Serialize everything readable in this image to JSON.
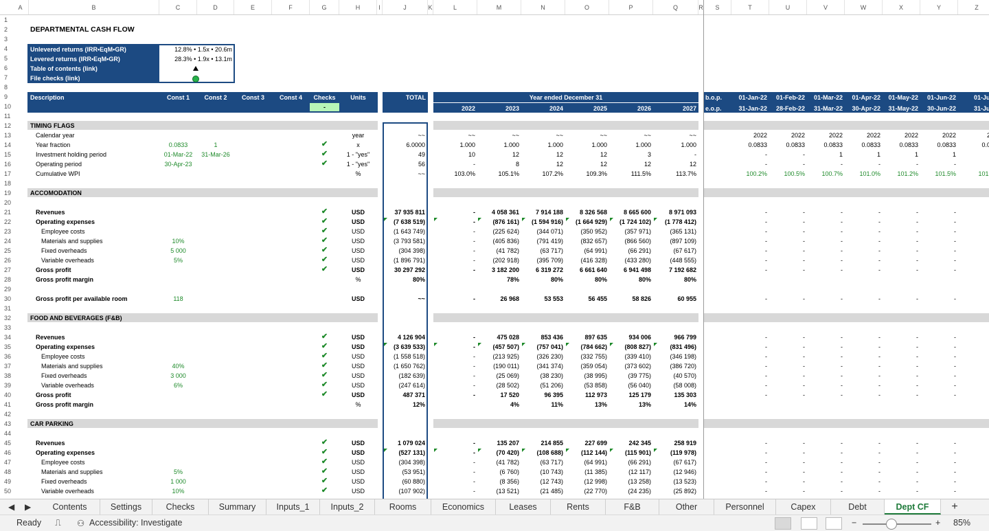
{
  "columns": [
    "A",
    "B",
    "C",
    "D",
    "E",
    "F",
    "G",
    "H",
    "I",
    "J",
    "K",
    "L",
    "M",
    "N",
    "O",
    "P",
    "Q",
    "R",
    "S",
    "T",
    "U",
    "V",
    "W",
    "X",
    "Y",
    "Z"
  ],
  "title": "DEPARTMENTAL CASH FLOW",
  "summary_box": {
    "rows": [
      {
        "label": "Unlevered returns (IRR•EqM•GR)",
        "value": "12.8% • 1.5x • 20.6m"
      },
      {
        "label": "Levered returns (IRR•EqM•GR)",
        "value": "28.3% • 1.9x • 13.1m"
      },
      {
        "label": "Table of contents (link)",
        "value": ""
      },
      {
        "label": "File checks (link)",
        "value": ""
      }
    ]
  },
  "header": {
    "description": "Description",
    "const": [
      "Const 1",
      "Const 2",
      "Const 3",
      "Const 4"
    ],
    "checks": "Checks",
    "checks_value": "-",
    "units": "Units",
    "total": "TOTAL",
    "year_ended": "Year ended December 31",
    "years": [
      "2022",
      "2023",
      "2024",
      "2025",
      "2026",
      "2027"
    ],
    "bop": "b.o.p.",
    "eop": "e.o.p.",
    "month_starts": [
      "01-Jan-22",
      "01-Feb-22",
      "01-Mar-22",
      "01-Apr-22",
      "01-May-22",
      "01-Jun-22",
      "01-Jul-"
    ],
    "month_ends": [
      "31-Jan-22",
      "28-Feb-22",
      "31-Mar-22",
      "30-Apr-22",
      "31-May-22",
      "30-Jun-22",
      "31-Jul-"
    ]
  },
  "rows": [
    {
      "r": 12,
      "type": "section",
      "label": "TIMING FLAGS"
    },
    {
      "r": 13,
      "label": "Calendar year",
      "units": "year",
      "total": "~~",
      "years": [
        "~~",
        "~~",
        "~~",
        "~~",
        "~~",
        "~~"
      ],
      "months": [
        "2022",
        "2022",
        "2022",
        "2022",
        "2022",
        "2022",
        "20"
      ]
    },
    {
      "r": 14,
      "label": "Year fraction",
      "c1": "0.0833",
      "c2": "1",
      "check": true,
      "units": "x",
      "total": "6.0000",
      "years": [
        "1.000",
        "1.000",
        "1.000",
        "1.000",
        "1.000",
        "1.000"
      ],
      "months": [
        "0.0833",
        "0.0833",
        "0.0833",
        "0.0833",
        "0.0833",
        "0.0833",
        "0.08"
      ]
    },
    {
      "r": 15,
      "label": "Investment holding period",
      "c1": "01-Mar-22",
      "c2": "31-Mar-26",
      "check": true,
      "units": "1 - \"yes\"",
      "total": "49",
      "years": [
        "10",
        "12",
        "12",
        "12",
        "3",
        "-"
      ],
      "months": [
        "-",
        "-",
        "1",
        "1",
        "1",
        "1",
        ""
      ]
    },
    {
      "r": 16,
      "label": "Operating period",
      "c1": "30-Apr-23",
      "check": true,
      "units": "1 - \"yes\"",
      "total": "56",
      "years": [
        "-",
        "8",
        "12",
        "12",
        "12",
        "12"
      ],
      "months": [
        "-",
        "-",
        "-",
        "-",
        "-",
        "-",
        ""
      ]
    },
    {
      "r": 17,
      "label": "Cumulative WPI",
      "units": "%",
      "total": "~~",
      "years": [
        "103.0%",
        "105.1%",
        "107.2%",
        "109.3%",
        "111.5%",
        "113.7%"
      ],
      "months": [
        "100.2%",
        "100.5%",
        "100.7%",
        "101.0%",
        "101.2%",
        "101.5%",
        "101.7"
      ],
      "mgreen": true
    },
    {
      "r": 19,
      "type": "section",
      "label": "ACCOMODATION"
    },
    {
      "r": 21,
      "label": "Revenues",
      "bold": true,
      "check": true,
      "units": "USD",
      "total": "37 935 811",
      "years": [
        "-",
        "4 058 361",
        "7 914 188",
        "8 326 568",
        "8 665 600",
        "8 971 093"
      ],
      "months": [
        "-",
        "-",
        "-",
        "-",
        "-",
        "-",
        ""
      ]
    },
    {
      "r": 22,
      "label": "Operating expenses",
      "bold": true,
      "check": true,
      "units": "USD",
      "total": "(7 638 519)",
      "years": [
        "-",
        "(876 161)",
        "(1 594 916)",
        "(1 664 929)",
        "(1 724 102)",
        "(1 778 412)"
      ],
      "months": [
        "-",
        "-",
        "-",
        "-",
        "-",
        "-",
        ""
      ],
      "tri": true
    },
    {
      "r": 23,
      "label": "Employee costs",
      "indent": true,
      "check": true,
      "units": "USD",
      "total": "(1 643 749)",
      "years": [
        "-",
        "(225 624)",
        "(344 071)",
        "(350 952)",
        "(357 971)",
        "(365 131)"
      ],
      "months": [
        "-",
        "-",
        "-",
        "-",
        "-",
        "-",
        ""
      ]
    },
    {
      "r": 24,
      "label": "Materials and supplies",
      "indent": true,
      "c1": "10%",
      "check": true,
      "units": "USD",
      "total": "(3 793 581)",
      "years": [
        "-",
        "(405 836)",
        "(791 419)",
        "(832 657)",
        "(866 560)",
        "(897 109)"
      ],
      "months": [
        "-",
        "-",
        "-",
        "-",
        "-",
        "-",
        ""
      ]
    },
    {
      "r": 25,
      "label": "Fixed overheads",
      "indent": true,
      "c1": "5 000",
      "check": true,
      "units": "USD",
      "total": "(304 398)",
      "years": [
        "-",
        "(41 782)",
        "(63 717)",
        "(64 991)",
        "(66 291)",
        "(67 617)"
      ],
      "months": [
        "-",
        "-",
        "-",
        "-",
        "-",
        "-",
        ""
      ]
    },
    {
      "r": 26,
      "label": "Variable overheads",
      "indent": true,
      "c1": "5%",
      "check": true,
      "units": "USD",
      "total": "(1 896 791)",
      "years": [
        "-",
        "(202 918)",
        "(395 709)",
        "(416 328)",
        "(433 280)",
        "(448 555)"
      ],
      "months": [
        "-",
        "-",
        "-",
        "-",
        "-",
        "-",
        ""
      ]
    },
    {
      "r": 27,
      "label": "Gross profit",
      "bold": true,
      "check": true,
      "units": "USD",
      "total": "30 297 292",
      "years": [
        "-",
        "3 182 200",
        "6 319 272",
        "6 661 640",
        "6 941 498",
        "7 192 682"
      ],
      "months": [
        "-",
        "-",
        "-",
        "-",
        "-",
        "-",
        ""
      ]
    },
    {
      "r": 28,
      "label": "Gross profit margin",
      "bold": true,
      "units": "%",
      "total": "80%",
      "years": [
        "",
        "78%",
        "80%",
        "80%",
        "80%",
        "80%"
      ],
      "months": [
        "",
        "",
        "",
        "",
        "",
        "",
        ""
      ]
    },
    {
      "r": 30,
      "label": "Gross profit per available room",
      "bold": true,
      "c1": "118",
      "units": "USD",
      "total": "~~",
      "years": [
        "-",
        "26 968",
        "53 553",
        "56 455",
        "58 826",
        "60 955"
      ],
      "months": [
        "-",
        "-",
        "-",
        "-",
        "-",
        "-",
        ""
      ]
    },
    {
      "r": 32,
      "type": "section",
      "label": "FOOD AND BEVERAGES (F&B)"
    },
    {
      "r": 34,
      "label": "Revenues",
      "bold": true,
      "check": true,
      "units": "USD",
      "total": "4 126 904",
      "years": [
        "-",
        "475 028",
        "853 436",
        "897 635",
        "934 006",
        "966 799"
      ],
      "months": [
        "-",
        "-",
        "-",
        "-",
        "-",
        "-",
        ""
      ]
    },
    {
      "r": 35,
      "label": "Operating expenses",
      "bold": true,
      "check": true,
      "units": "USD",
      "total": "(3 639 533)",
      "years": [
        "-",
        "(457 507)",
        "(757 041)",
        "(784 662)",
        "(808 827)",
        "(831 496)"
      ],
      "months": [
        "-",
        "-",
        "-",
        "-",
        "-",
        "-",
        ""
      ],
      "tri": true
    },
    {
      "r": 36,
      "label": "Employee costs",
      "indent": true,
      "check": true,
      "units": "USD",
      "total": "(1 558 518)",
      "years": [
        "-",
        "(213 925)",
        "(326 230)",
        "(332 755)",
        "(339 410)",
        "(346 198)"
      ],
      "months": [
        "-",
        "-",
        "-",
        "-",
        "-",
        "-",
        ""
      ]
    },
    {
      "r": 37,
      "label": "Materials and supplies",
      "indent": true,
      "c1": "40%",
      "check": true,
      "units": "USD",
      "total": "(1 650 762)",
      "years": [
        "-",
        "(190 011)",
        "(341 374)",
        "(359 054)",
        "(373 602)",
        "(386 720)"
      ],
      "months": [
        "-",
        "-",
        "-",
        "-",
        "-",
        "-",
        ""
      ]
    },
    {
      "r": 38,
      "label": "Fixed overheads",
      "indent": true,
      "c1": "3 000",
      "check": true,
      "units": "USD",
      "total": "(182 639)",
      "years": [
        "-",
        "(25 069)",
        "(38 230)",
        "(38 995)",
        "(39 775)",
        "(40 570)"
      ],
      "months": [
        "-",
        "-",
        "-",
        "-",
        "-",
        "-",
        ""
      ]
    },
    {
      "r": 39,
      "label": "Variable overheads",
      "indent": true,
      "c1": "6%",
      "check": true,
      "units": "USD",
      "total": "(247 614)",
      "years": [
        "-",
        "(28 502)",
        "(51 206)",
        "(53 858)",
        "(56 040)",
        "(58 008)"
      ],
      "months": [
        "-",
        "-",
        "-",
        "-",
        "-",
        "-",
        ""
      ]
    },
    {
      "r": 40,
      "label": "Gross profit",
      "bold": true,
      "check": true,
      "units": "USD",
      "total": "487 371",
      "years": [
        "-",
        "17 520",
        "96 395",
        "112 973",
        "125 179",
        "135 303"
      ],
      "months": [
        "-",
        "-",
        "-",
        "-",
        "-",
        "-",
        ""
      ]
    },
    {
      "r": 41,
      "label": "Gross profit margin",
      "bold": true,
      "units": "%",
      "total": "12%",
      "years": [
        "",
        "4%",
        "11%",
        "13%",
        "13%",
        "14%"
      ],
      "months": [
        "",
        "",
        "",
        "",
        "",
        "",
        ""
      ]
    },
    {
      "r": 43,
      "type": "section",
      "label": "CAR PARKING"
    },
    {
      "r": 45,
      "label": "Revenues",
      "bold": true,
      "check": true,
      "units": "USD",
      "total": "1 079 024",
      "years": [
        "-",
        "135 207",
        "214 855",
        "227 699",
        "242 345",
        "258 919"
      ],
      "months": [
        "-",
        "-",
        "-",
        "-",
        "-",
        "-",
        ""
      ]
    },
    {
      "r": 46,
      "label": "Operating expenses",
      "bold": true,
      "check": true,
      "units": "USD",
      "total": "(527 131)",
      "years": [
        "-",
        "(70 420)",
        "(108 688)",
        "(112 144)",
        "(115 901)",
        "(119 978)"
      ],
      "months": [
        "-",
        "-",
        "-",
        "-",
        "-",
        "-",
        ""
      ],
      "tri": true
    },
    {
      "r": 47,
      "label": "Employee costs",
      "indent": true,
      "check": true,
      "units": "USD",
      "total": "(304 398)",
      "years": [
        "-",
        "(41 782)",
        "(63 717)",
        "(64 991)",
        "(66 291)",
        "(67 617)"
      ],
      "months": [
        "-",
        "-",
        "-",
        "-",
        "-",
        "-",
        ""
      ]
    },
    {
      "r": 48,
      "label": "Materials and supplies",
      "indent": true,
      "c1": "5%",
      "check": true,
      "units": "USD",
      "total": "(53 951)",
      "years": [
        "-",
        "(6 760)",
        "(10 743)",
        "(11 385)",
        "(12 117)",
        "(12 946)"
      ],
      "months": [
        "-",
        "-",
        "-",
        "-",
        "-",
        "-",
        ""
      ]
    },
    {
      "r": 49,
      "label": "Fixed overheads",
      "indent": true,
      "c1": "1 000",
      "check": true,
      "units": "USD",
      "total": "(60 880)",
      "years": [
        "-",
        "(8 356)",
        "(12 743)",
        "(12 998)",
        "(13 258)",
        "(13 523)"
      ],
      "months": [
        "-",
        "-",
        "-",
        "-",
        "-",
        "-",
        ""
      ]
    },
    {
      "r": 50,
      "label": "Variable overheads",
      "indent": true,
      "c1": "10%",
      "check": true,
      "units": "USD",
      "total": "(107 902)",
      "years": [
        "-",
        "(13 521)",
        "(21 485)",
        "(22 770)",
        "(24 235)",
        "(25 892)"
      ],
      "months": [
        "-",
        "-",
        "-",
        "-",
        "-",
        "-",
        ""
      ]
    }
  ],
  "tabs": [
    "Contents",
    "Settings",
    "Checks",
    "Summary",
    "Inputs_1",
    "Inputs_2",
    "Rooms",
    "Economics",
    "Leases",
    "Rents",
    "F&B",
    "Other",
    "Personnel",
    "Capex",
    "Debt",
    "Dept CF"
  ],
  "active_tab": "Dept CF",
  "add_tab_label": "+",
  "status": {
    "ready": "Ready",
    "accessibility": "Accessibility: Investigate",
    "zoom": "85%"
  },
  "icons": {
    "prev_sheet": "chevron-left-icon",
    "next_sheet": "chevron-right-icon",
    "check": "checkmark-icon",
    "file_checks": "green-dot-icon"
  },
  "colors": {
    "accent_blue": "#1c4a82",
    "input_green": "#1e8a2a",
    "section_grey": "#d8d8d8",
    "active_tab": "#1e7a3a"
  }
}
